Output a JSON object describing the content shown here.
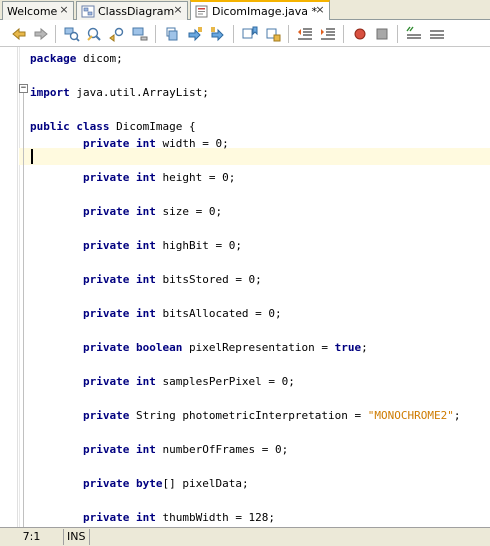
{
  "tabs": [
    {
      "label": "Welcome",
      "active": false
    },
    {
      "label": "ClassDiagram",
      "active": false
    },
    {
      "label": "DicomImage.java *",
      "active": true
    }
  ],
  "toolbar": {
    "buttons": [
      "back-icon",
      "forward-icon",
      "find-selection-icon",
      "find-icon",
      "find-previous-icon",
      "find-next-icon",
      "toggle-highlight-icon",
      "previous-bookmark-icon",
      "next-bookmark-icon",
      "toggle-bookmark-icon",
      "next-error-icon",
      "shift-left-icon",
      "shift-right-icon",
      "start-macro-icon",
      "stop-macro-icon",
      "comment-icon",
      "uncomment-icon"
    ]
  },
  "editor": {
    "lines": [
      [
        {
          "t": "package",
          "k": "kw"
        },
        {
          "t": " dicom;"
        }
      ],
      [
        {
          "t": "import",
          "k": "kw"
        },
        {
          "t": " java.util.ArrayList;"
        }
      ],
      [
        {
          "t": "public",
          "k": "kw"
        },
        {
          "t": " "
        },
        {
          "t": "class",
          "k": "kw"
        },
        {
          "t": " DicomImage {"
        }
      ],
      [
        {
          "t": "        "
        },
        {
          "t": "private",
          "k": "kw"
        },
        {
          "t": " "
        },
        {
          "t": "int",
          "k": "kw"
        },
        {
          "t": " width = 0;"
        }
      ],
      [
        {
          "t": "        "
        },
        {
          "t": "private",
          "k": "kw"
        },
        {
          "t": " "
        },
        {
          "t": "int",
          "k": "kw"
        },
        {
          "t": " height = 0;"
        }
      ],
      [
        {
          "t": "        "
        },
        {
          "t": "private",
          "k": "kw"
        },
        {
          "t": " "
        },
        {
          "t": "int",
          "k": "kw"
        },
        {
          "t": " size = 0;"
        }
      ],
      [
        {
          "t": "        "
        },
        {
          "t": "private",
          "k": "kw"
        },
        {
          "t": " "
        },
        {
          "t": "int",
          "k": "kw"
        },
        {
          "t": " highBit = 0;"
        }
      ],
      [
        {
          "t": "        "
        },
        {
          "t": "private",
          "k": "kw"
        },
        {
          "t": " "
        },
        {
          "t": "int",
          "k": "kw"
        },
        {
          "t": " bitsStored = 0;"
        }
      ],
      [
        {
          "t": "        "
        },
        {
          "t": "private",
          "k": "kw"
        },
        {
          "t": " "
        },
        {
          "t": "int",
          "k": "kw"
        },
        {
          "t": " bitsAllocated = 0;"
        }
      ],
      [
        {
          "t": "        "
        },
        {
          "t": "private",
          "k": "kw"
        },
        {
          "t": " "
        },
        {
          "t": "boolean",
          "k": "kw"
        },
        {
          "t": " pixelRepresentation = "
        },
        {
          "t": "true",
          "k": "kw"
        },
        {
          "t": ";"
        }
      ],
      [
        {
          "t": "        "
        },
        {
          "t": "private",
          "k": "kw"
        },
        {
          "t": " "
        },
        {
          "t": "int",
          "k": "kw"
        },
        {
          "t": " samplesPerPixel = 0;"
        }
      ],
      [
        {
          "t": "        "
        },
        {
          "t": "private",
          "k": "kw"
        },
        {
          "t": " String photometricInterpretation = "
        },
        {
          "t": "\"MONOCHROME2\"",
          "k": "str"
        },
        {
          "t": ";"
        }
      ],
      [
        {
          "t": "        "
        },
        {
          "t": "private",
          "k": "kw"
        },
        {
          "t": " "
        },
        {
          "t": "int",
          "k": "kw"
        },
        {
          "t": " numberOfFrames = 0;"
        }
      ],
      [
        {
          "t": "        "
        },
        {
          "t": "private",
          "k": "kw"
        },
        {
          "t": " "
        },
        {
          "t": "byte",
          "k": "kw"
        },
        {
          "t": "[] pixelData;"
        }
      ],
      [
        {
          "t": "        "
        },
        {
          "t": "private",
          "k": "kw"
        },
        {
          "t": " "
        },
        {
          "t": "int",
          "k": "kw"
        },
        {
          "t": " thumbWidth = 128;"
        }
      ]
    ],
    "fold_marker": "−"
  },
  "status": {
    "position": "7:1",
    "mode": "INS"
  },
  "colors": {
    "keyword": "#000080",
    "string": "#ce7b00",
    "current_line": "#fffadf"
  }
}
